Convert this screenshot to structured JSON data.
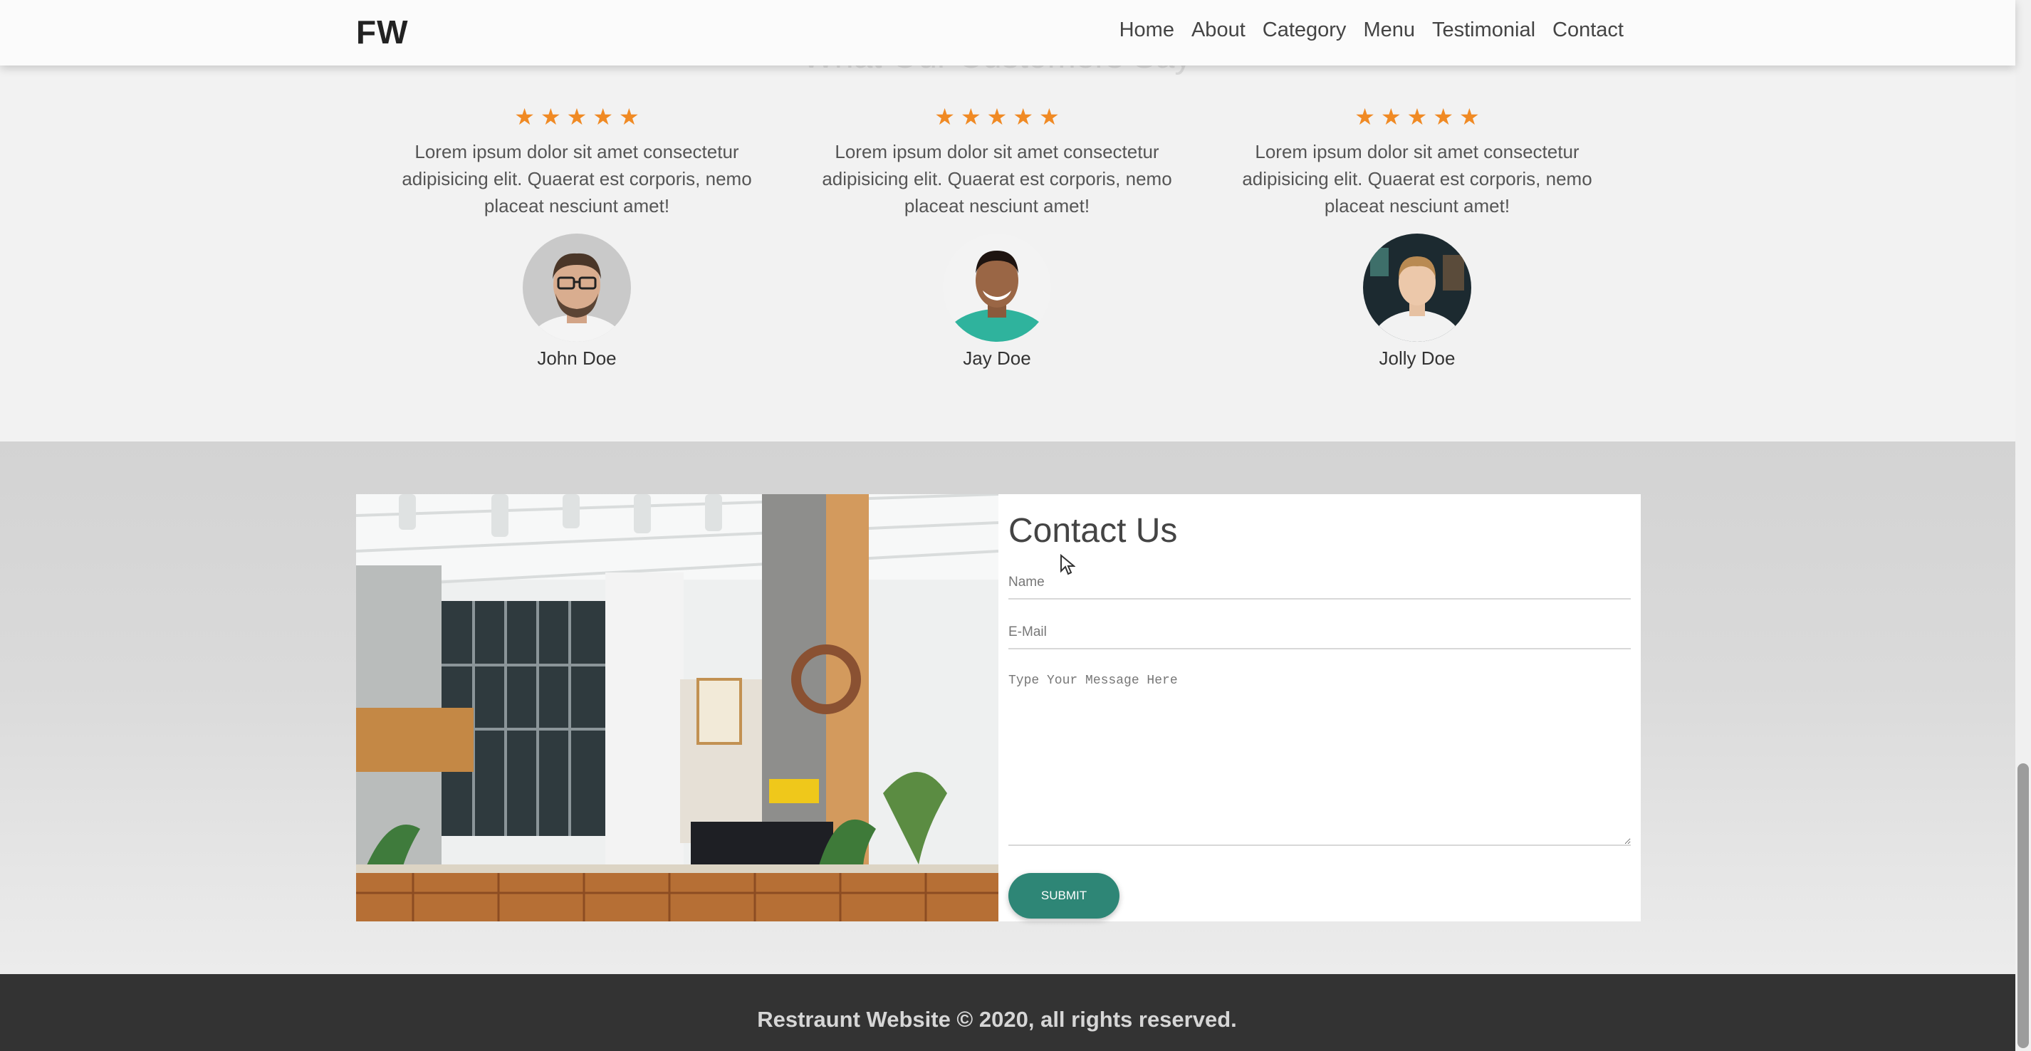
{
  "nav": {
    "logo": "FW",
    "links": [
      "Home",
      "About",
      "Category",
      "Menu",
      "Testimonial",
      "Contact"
    ]
  },
  "testimonials": {
    "title": "What Our Customers Say",
    "star_color": "#f08a24",
    "items": [
      {
        "rating": 5,
        "text": "Lorem ipsum dolor sit amet consectetur adipisicing elit. Quaerat est corporis, nemo placeat nesciunt amet!",
        "name": "John Doe"
      },
      {
        "rating": 5,
        "text": "Lorem ipsum dolor sit amet consectetur adipisicing elit. Quaerat est corporis, nemo placeat nesciunt amet!",
        "name": "Jay Doe"
      },
      {
        "rating": 5,
        "text": "Lorem ipsum dolor sit amet consectetur adipisicing elit. Quaerat est corporis, nemo placeat nesciunt amet!",
        "name": "Jolly Doe"
      }
    ]
  },
  "contact": {
    "title": "Contact Us",
    "name_placeholder": "Name",
    "email_placeholder": "E-Mail",
    "message_placeholder": "Type Your Message Here",
    "submit_label": "SUBMIT",
    "accent_color": "#2e8676"
  },
  "footer": {
    "text": "Restraunt Website © 2020, all rights reserved."
  }
}
